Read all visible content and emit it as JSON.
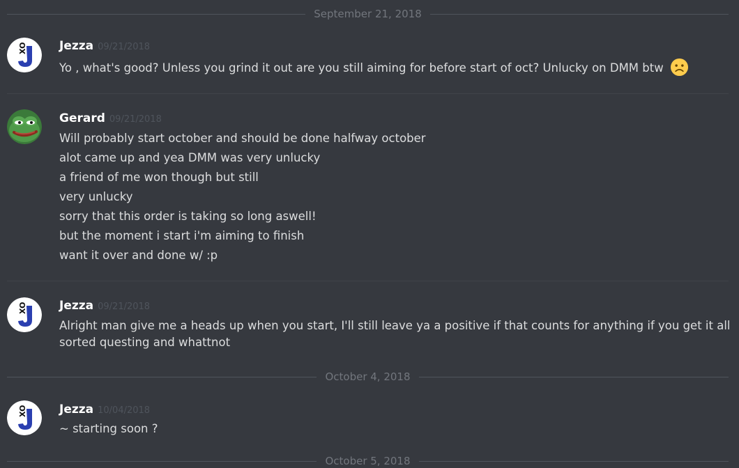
{
  "dividers": [
    "September 21, 2018",
    "October 4, 2018",
    "October 5, 2018"
  ],
  "messages": [
    {
      "author": "Jezza",
      "timestamp": "09/21/2018",
      "lines": [
        "Yo , what's good? Unless you grind it out are you still aiming for before start of oct? Unlucky on DMM btw"
      ],
      "emoji": "frowning-face"
    },
    {
      "author": "Gerard",
      "timestamp": "09/21/2018",
      "lines": [
        "Will probably start october and should be done halfway october",
        "alot came up and yea DMM was very unlucky",
        "a friend of me won though but still",
        "very unlucky",
        "sorry that this order is taking so long aswell!",
        "but the moment i start i'm aiming to finish",
        "want it over and done w/ :p"
      ]
    },
    {
      "author": "Jezza",
      "timestamp": "09/21/2018",
      "lines": [
        "Alright man give me a heads up when you start, I'll still leave ya a positive if that counts for anything if you get it all",
        "sorted questing and whattnot"
      ]
    },
    {
      "author": "Jezza",
      "timestamp": "10/04/2018",
      "lines": [
        "~ starting soon ?"
      ]
    }
  ],
  "avatar_glyphs": {
    "jezza_small": "XO",
    "jezza_big": "J"
  },
  "colors": {
    "background": "#36393f",
    "text": "#dcddde",
    "author": "#ffffff",
    "muted": "#72767d",
    "jezza_blue": "#2b3fb0"
  }
}
